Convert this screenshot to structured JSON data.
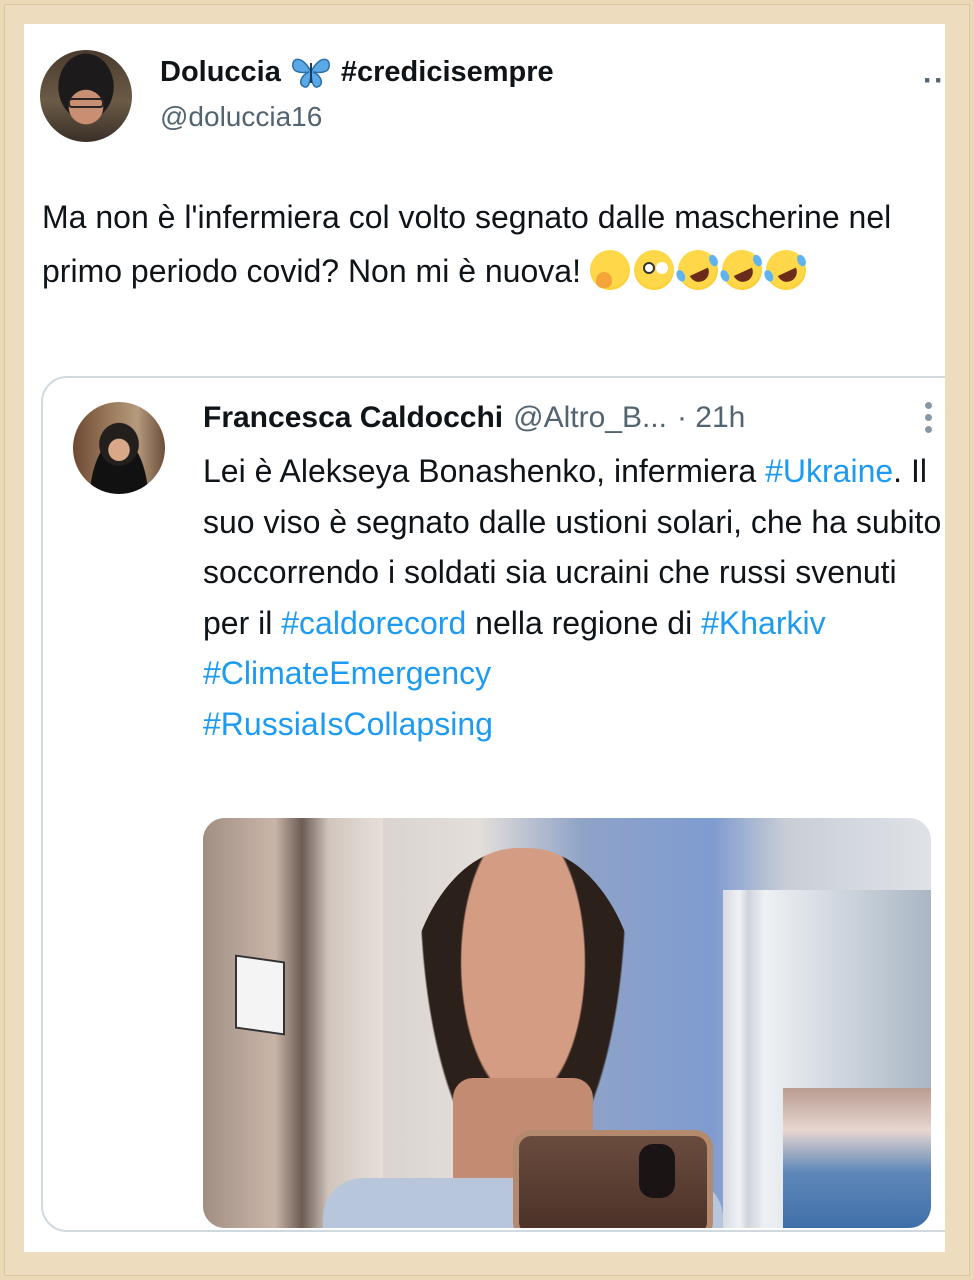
{
  "tweet": {
    "author_name": "Doluccia",
    "author_hashtag": "#credicisempre",
    "author_handle": "@doluccia16",
    "more_label": "··",
    "text": "Ma non è l'infermiera col volto segnato dalle mascherine nel primo periodo covid? Non mi è nuova!",
    "emojis": [
      "thinking-face",
      "face-with-rolling-eyes",
      "rolling-on-the-floor-laughing",
      "rolling-on-the-floor-laughing",
      "rolling-on-the-floor-laughing"
    ]
  },
  "quote": {
    "author_name": "Francesca Caldocchi",
    "author_handle": "@Altro_B...",
    "time": "· 21h",
    "text_parts": {
      "p1": "Lei è Alekseya Bonashenko, infermiera ",
      "tag1": "#Ukraine",
      "p2": ". Il suo viso è segnato dalle ustioni solari, che ha subito soccorrendo i soldati sia ucraini che russi svenuti per il ",
      "tag2": "#caldorecord",
      "p3": " nella regione di ",
      "tag3": "#Kharkiv",
      "tag4": "#ClimateEmergency",
      "tag5": "#RussiaIsCollapsing"
    }
  },
  "colors": {
    "link": "#1d9bf0",
    "secondary_text": "#536471",
    "frame": "#ead8b6",
    "border": "#cfd9de"
  }
}
